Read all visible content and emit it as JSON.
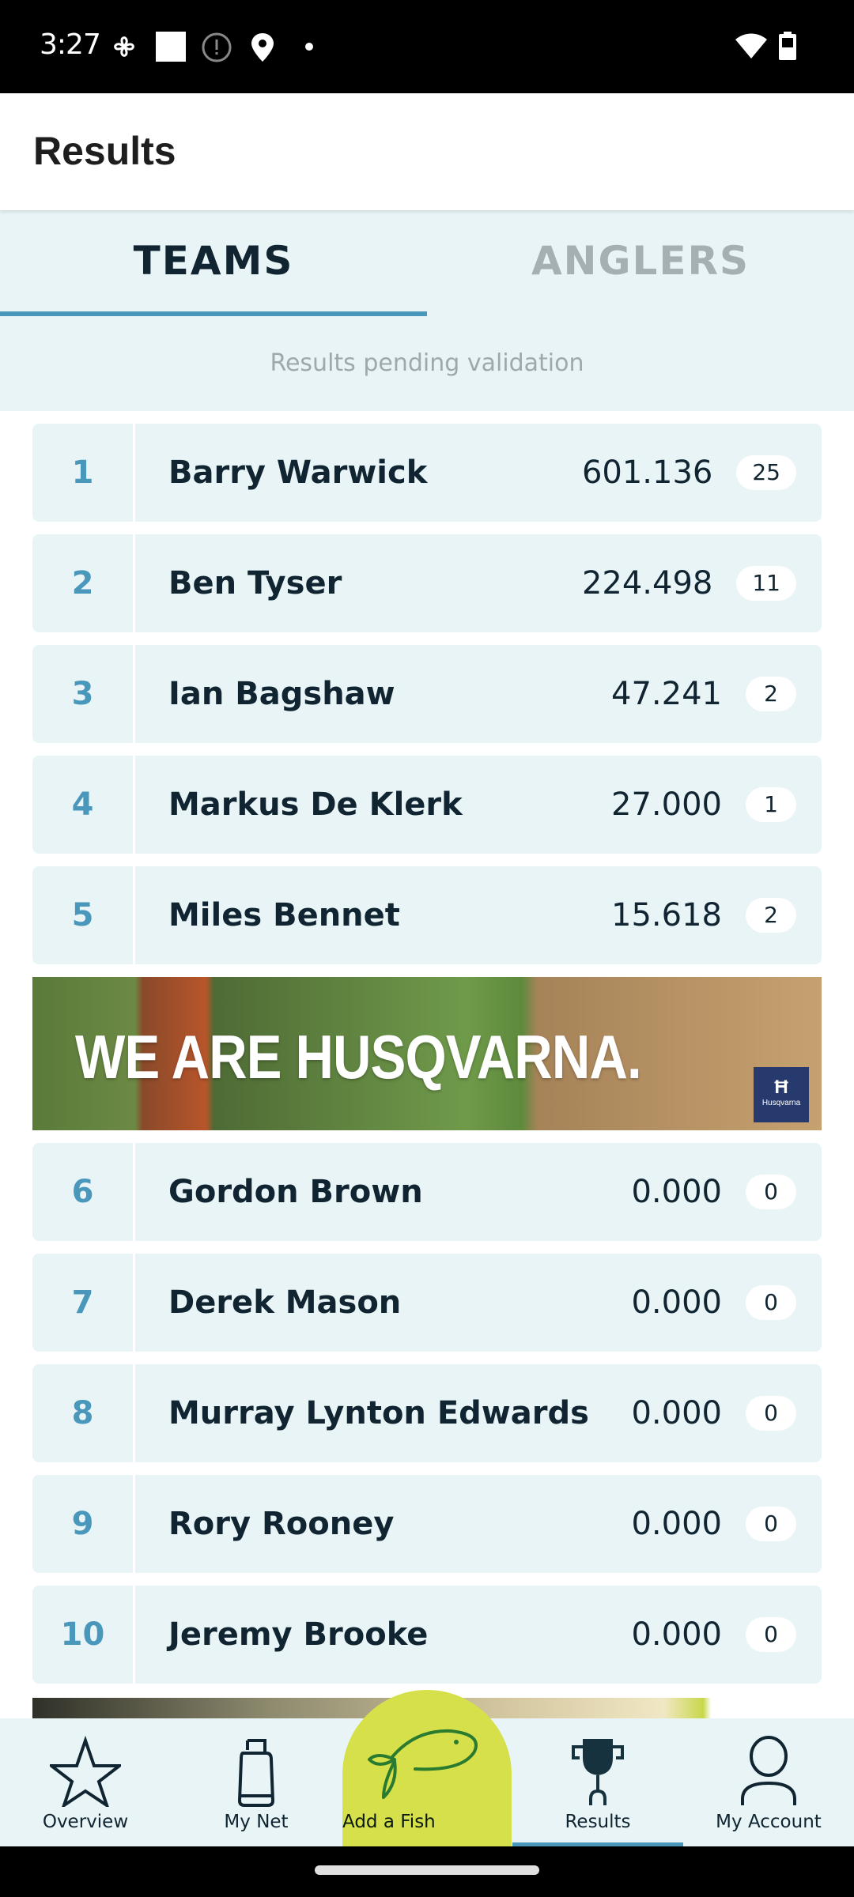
{
  "status_bar": {
    "time": "3:27",
    "icons": [
      "pinwheel-icon",
      "square-icon",
      "alert-circle-icon",
      "location-pin-icon",
      "dot-icon",
      "wifi-icon",
      "battery-icon"
    ]
  },
  "app_bar": {
    "title": "Results"
  },
  "tabs": [
    {
      "label": "TEAMS",
      "active": true
    },
    {
      "label": "ANGLERS",
      "active": false
    }
  ],
  "notice": "Results pending validation",
  "results": [
    {
      "rank": "1",
      "name": "Barry Warwick",
      "score": "601.136",
      "count": "25"
    },
    {
      "rank": "2",
      "name": "Ben Tyser",
      "score": "224.498",
      "count": "11"
    },
    {
      "rank": "3",
      "name": "Ian Bagshaw",
      "score": "47.241",
      "count": "2"
    },
    {
      "rank": "4",
      "name": "Markus De Klerk",
      "score": "27.000",
      "count": "1"
    },
    {
      "rank": "5",
      "name": "Miles Bennet",
      "score": "15.618",
      "count": "2"
    },
    {
      "rank": "6",
      "name": "Gordon Brown",
      "score": "0.000",
      "count": "0"
    },
    {
      "rank": "7",
      "name": "Derek Mason",
      "score": "0.000",
      "count": "0"
    },
    {
      "rank": "8",
      "name": "Murray Lynton Edwards",
      "score": "0.000",
      "count": "0"
    },
    {
      "rank": "9",
      "name": "Rory Rooney",
      "score": "0.000",
      "count": "0"
    },
    {
      "rank": "10",
      "name": "Jeremy Brooke",
      "score": "0.000",
      "count": "0"
    }
  ],
  "ad_banner": {
    "headline": "WE ARE HUSQVARNA.",
    "brand": "Husqvarna"
  },
  "bottom_nav": [
    {
      "label": "Overview",
      "icon": "star-icon"
    },
    {
      "label": "My Net",
      "icon": "keepnet-icon"
    },
    {
      "label": "Add a Fish",
      "icon": "fish-icon"
    },
    {
      "label": "Results",
      "icon": "trophy-icon",
      "active": true
    },
    {
      "label": "My Account",
      "icon": "person-icon"
    }
  ],
  "colors": {
    "accent": "#4a97bc",
    "fab": "#d6e04a",
    "row_bg": "#e8f4f6",
    "text_dark": "#102531"
  }
}
